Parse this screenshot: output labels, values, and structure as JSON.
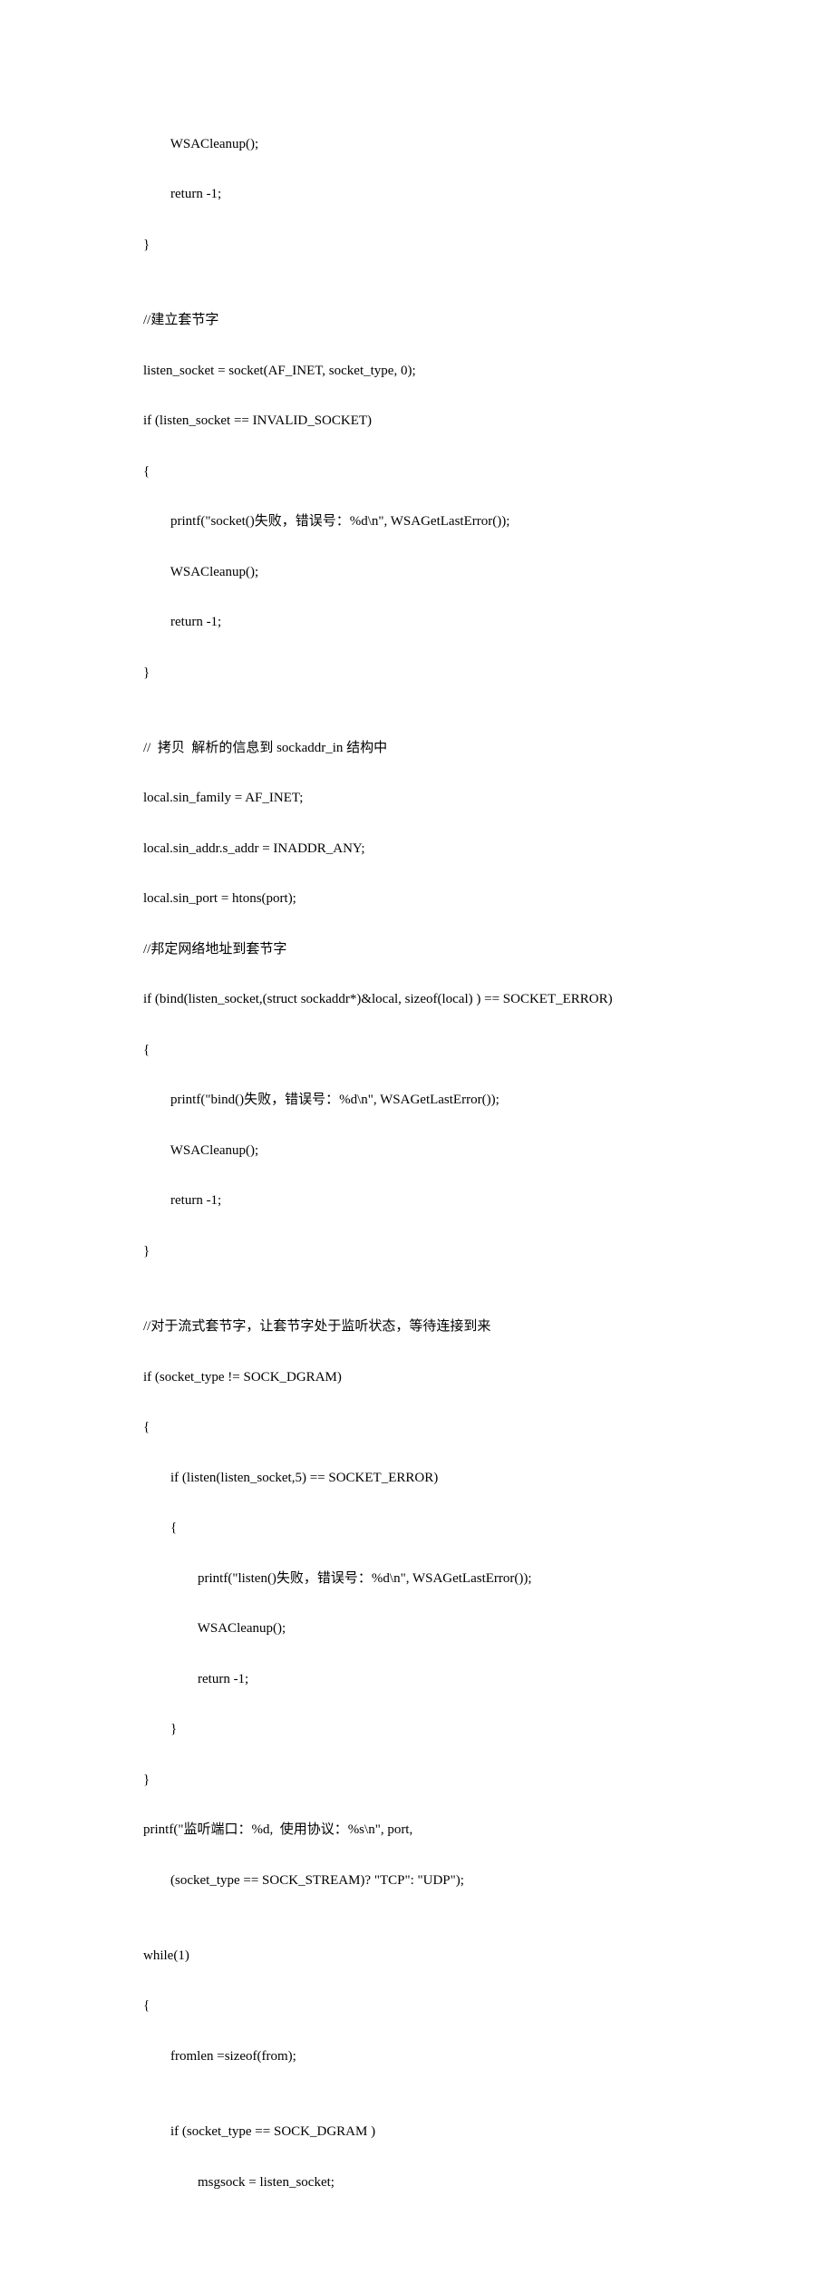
{
  "code": {
    "lines": [
      "        WSACleanup();",
      "        return -1;",
      "}",
      "",
      "//建立套节字",
      "listen_socket = socket(AF_INET, socket_type, 0);",
      "if (listen_socket == INVALID_SOCKET)",
      "{",
      "        printf(\"socket()失败，错误号：%d\\n\", WSAGetLastError());",
      "        WSACleanup();",
      "        return -1;",
      "}",
      "",
      "//  拷贝  解析的信息到 sockaddr_in 结构中",
      "local.sin_family = AF_INET;",
      "local.sin_addr.s_addr = INADDR_ANY;",
      "local.sin_port = htons(port);",
      "//邦定网络地址到套节字",
      "if (bind(listen_socket,(struct sockaddr*)&local, sizeof(local) ) == SOCKET_ERROR)",
      "{",
      "        printf(\"bind()失败，错误号：%d\\n\", WSAGetLastError());",
      "        WSACleanup();",
      "        return -1;",
      "}",
      "",
      "//对于流式套节字，让套节字处于监听状态，等待连接到来",
      "if (socket_type != SOCK_DGRAM)",
      "{",
      "        if (listen(listen_socket,5) == SOCKET_ERROR)",
      "        {",
      "                printf(\"listen()失败，错误号：%d\\n\", WSAGetLastError());",
      "                WSACleanup();",
      "                return -1;",
      "        }",
      "}",
      "printf(\"监听端口：%d,  使用协议：%s\\n\", port,",
      "        (socket_type == SOCK_STREAM)? \"TCP\": \"UDP\");",
      "",
      "while(1)",
      "{",
      "        fromlen =sizeof(from);",
      "",
      "        if (socket_type == SOCK_DGRAM )",
      "                msgsock = listen_socket;"
    ]
  }
}
